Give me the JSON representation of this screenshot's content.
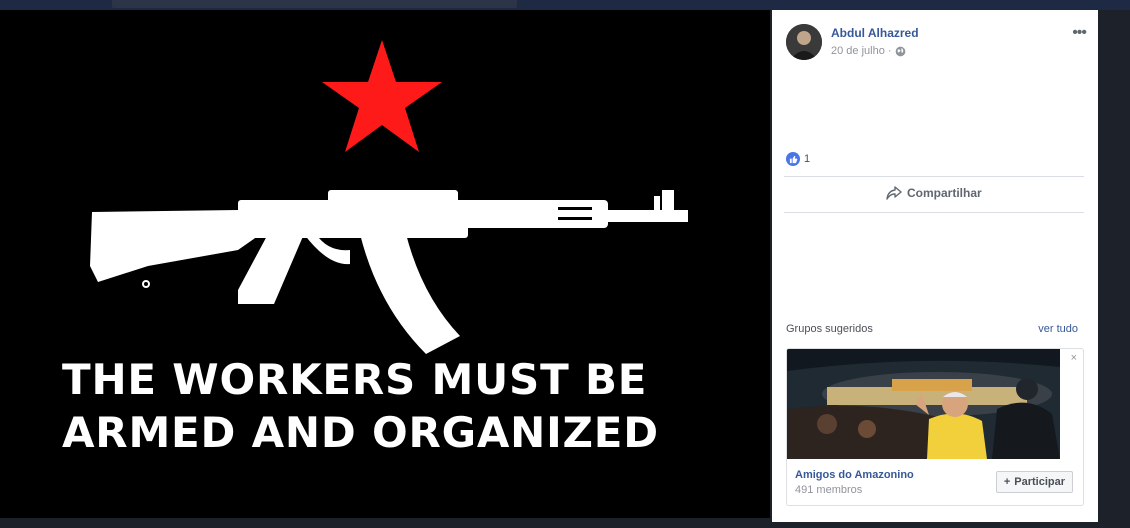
{
  "poster": {
    "line1": "THE WORKERS MUST BE",
    "line2": "ARMED AND ORGANIZED",
    "star_color": "#ff1a1a"
  },
  "post": {
    "author": "Abdul Alhazred",
    "date": "20 de julho",
    "privacy_separator": "·",
    "more_menu": "•••",
    "like_count": "1",
    "share_label": "Compartilhar"
  },
  "suggested_groups": {
    "heading": "Grupos sugeridos",
    "see_all": "ver tudo",
    "close": "×",
    "group_name": "Amigos do Amazonino",
    "members": "491 membros",
    "join_label": "Participar",
    "join_icon": "+"
  },
  "colors": {
    "link": "#365899",
    "like_blue": "#4a76e8",
    "header_navy": "#1e2a44"
  }
}
